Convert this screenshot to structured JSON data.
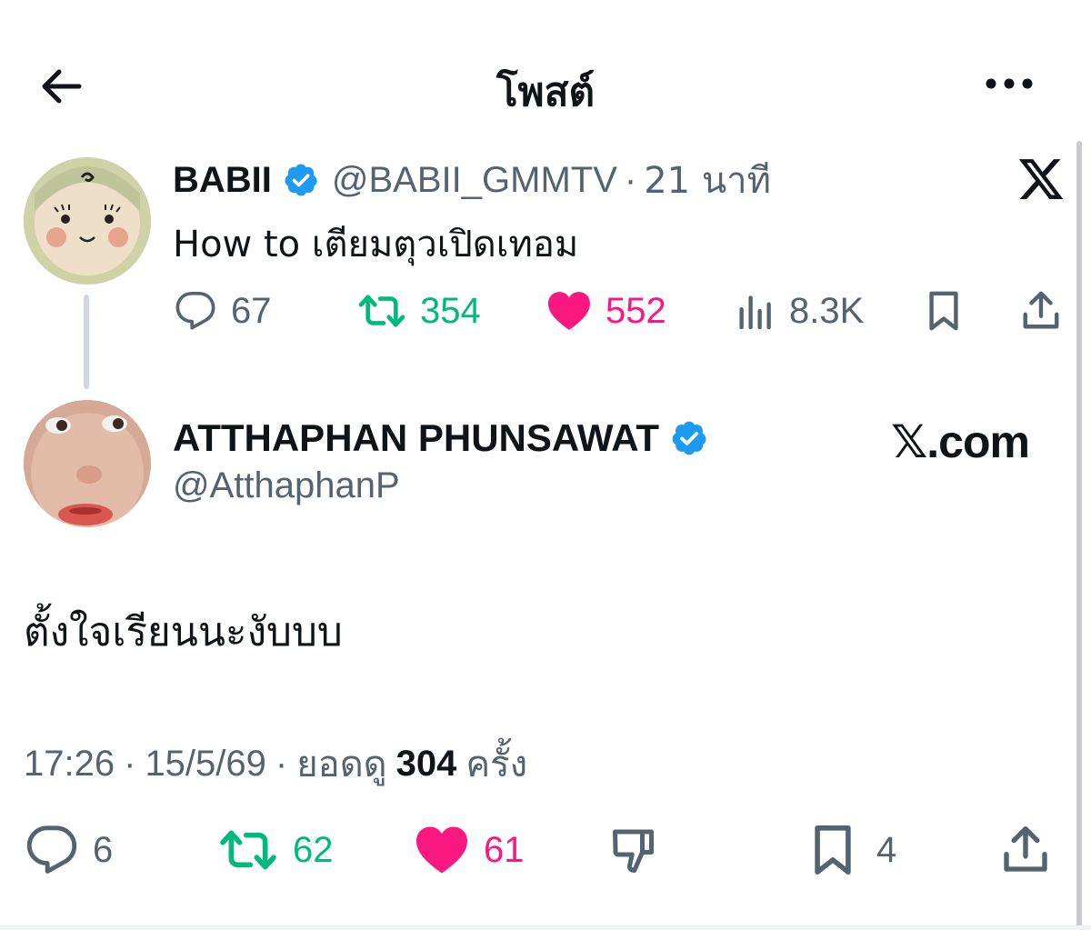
{
  "header": {
    "title": "โพสต์",
    "back_icon": "arrow-left-icon",
    "more_icon": "more-horizontal-icon"
  },
  "quoted_post": {
    "display_name": "BABII",
    "handle": "@BABII_GMMTV",
    "separator": "·",
    "time_ago": "21 นาที",
    "text": "How to เตียมตุวเปิดเทอม",
    "source_logo": "x-logo-icon",
    "actions": {
      "replies": "67",
      "reposts": "354",
      "likes": "552",
      "views": "8.3K"
    }
  },
  "post": {
    "display_name": "ATTHAPHAN PHUNSAWAT",
    "handle": "@AtthaphanP",
    "watermark": "𝕏.com",
    "text": "ตั้งใจเรียนนะงับบบ",
    "meta": {
      "time": "17:26",
      "date": "15/5/69",
      "separator": "·",
      "views_label": "ยอดดู",
      "views_count": "304",
      "views_suffix": "ครั้ง"
    },
    "actions": {
      "replies": "6",
      "reposts": "62",
      "likes": "61",
      "bookmarks": "4"
    }
  },
  "colors": {
    "verified": "#1d9bf0",
    "repost": "#00ba7c",
    "like": "#f91880",
    "secondary_text": "#536471",
    "primary_text": "#0f1419"
  }
}
